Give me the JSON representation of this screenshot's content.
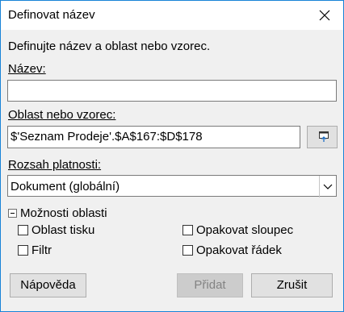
{
  "window": {
    "title": "Definovat název"
  },
  "dialog": {
    "description": "Definujte název a oblast nebo vzorec.",
    "name_label": "Název:",
    "name_value": "",
    "range_label": "Oblast nebo vzorec:",
    "range_value": "$'Seznam Prodeje'.$A$167:$D$178",
    "scope_label": "Rozsah platnosti:",
    "scope_value": "Dokument (globální)",
    "options_label": "Možnosti oblasti",
    "options": {
      "print_range": {
        "label": "Oblast tisku",
        "checked": false
      },
      "repeat_column": {
        "label": "Opakovat sloupec",
        "checked": false
      },
      "filter": {
        "label": "Filtr",
        "checked": false
      },
      "repeat_row": {
        "label": "Opakovat řádek",
        "checked": false
      }
    }
  },
  "buttons": {
    "help": "Nápověda",
    "add": "Přidat",
    "cancel": "Zrušit"
  },
  "colors": {
    "window_border": "#1883d7",
    "dialog_background": "#f0f0f0",
    "disabled_text": "#838383",
    "shrink_icon_accent": "#1f6fc5"
  },
  "icons": {
    "close": "close-icon",
    "shrink": "shrink-dialog-icon",
    "dropdown": "chevron-down-icon",
    "expander": "collapse-minus-icon"
  }
}
